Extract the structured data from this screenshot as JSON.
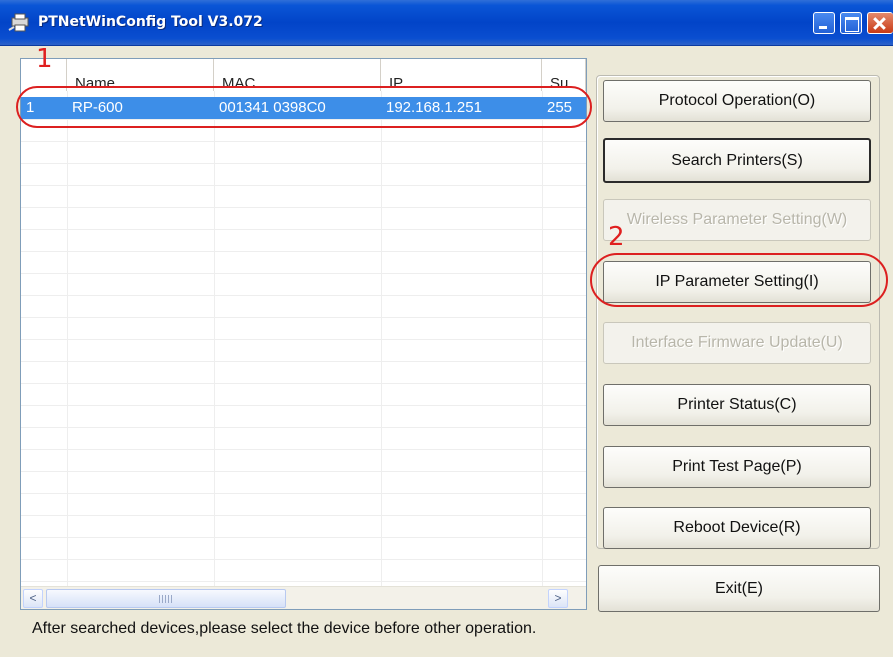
{
  "window": {
    "title": "PTNetWinConfig Tool V3.072"
  },
  "list": {
    "columns": [
      "Name",
      "MAC",
      "IP",
      "Su"
    ],
    "rows": [
      {
        "index": "1",
        "name": "RP-600",
        "mac": "001341 0398C0",
        "ip": "192.168.1.251",
        "subnet": "255"
      }
    ],
    "scroll_left": "<",
    "scroll_right": ">"
  },
  "buttons": {
    "protocol": "Protocol Operation(O)",
    "search": "Search Printers(S)",
    "wireless": "Wireless Parameter Setting(W)",
    "ip_setting": "IP Parameter Setting(I)",
    "firmware": "Interface Firmware Update(U)",
    "status": "Printer Status(C)",
    "test_page": "Print Test Page(P)",
    "reboot": "Reboot Device(R)",
    "exit": "Exit(E)"
  },
  "status_text": "After searched devices,please select the device before other operation.",
  "annotations": {
    "step1": "1",
    "step2": "2"
  },
  "colors": {
    "title_bar": "#0244c8",
    "selection": "#3d8ee8",
    "annotation": "#dc2020"
  }
}
